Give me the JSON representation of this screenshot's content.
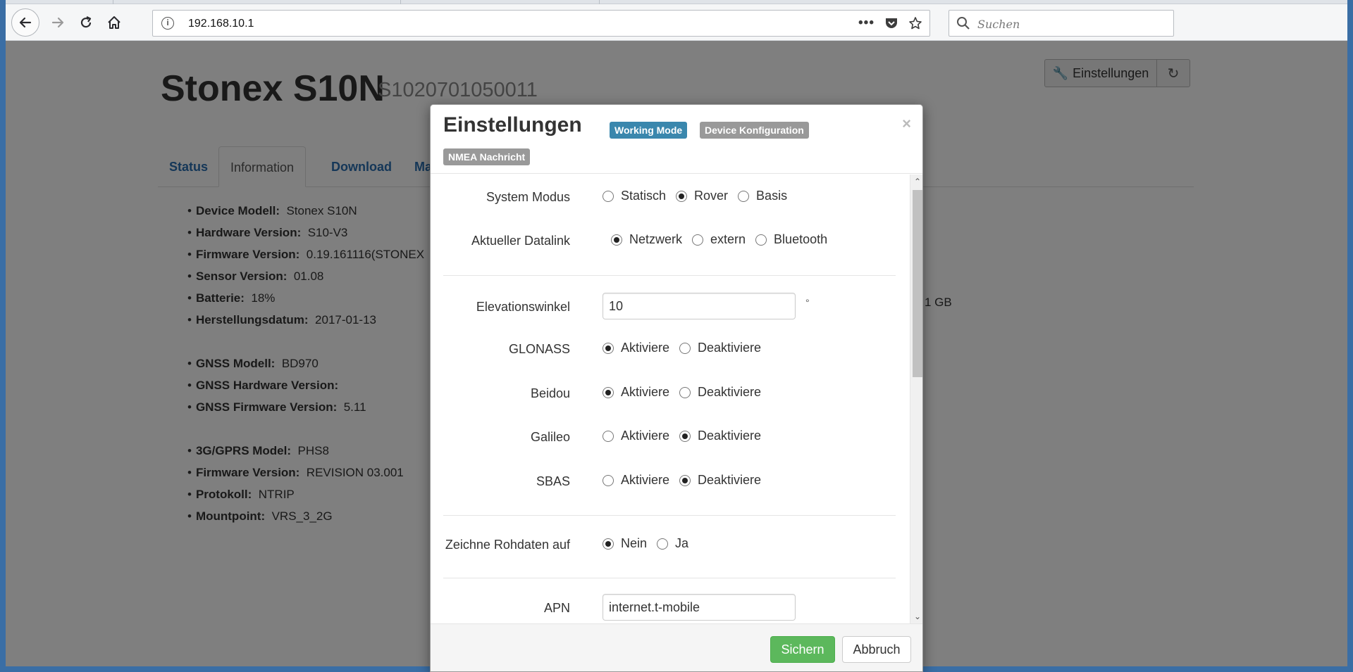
{
  "browser": {
    "url": "192.168.10.1",
    "search_placeholder": "Suchen",
    "page_actions": [
      "more-icon",
      "pocket-icon",
      "bookmark-star-icon"
    ]
  },
  "page": {
    "device_title": "Stonex S10N",
    "device_serial": "S1020701050011",
    "settings_button": "Einstellungen",
    "tabs": [
      "Status",
      "Information",
      "Download",
      "Ma"
    ],
    "active_tab": "Information",
    "info_groups": [
      [
        {
          "label": "Device Modell:",
          "value": "Stonex S10N"
        },
        {
          "label": "Hardware Version:",
          "value": "S10-V3"
        },
        {
          "label": "Firmware Version:",
          "value": "0.19.161116(STONEX"
        },
        {
          "label": "Sensor Version:",
          "value": "01.08"
        },
        {
          "label": "Batterie:",
          "value": "18%"
        },
        {
          "label": "Herstellungsdatum:",
          "value": "2017-01-13"
        }
      ],
      [
        {
          "label": "GNSS Modell:",
          "value": "BD970"
        },
        {
          "label": "GNSS Hardware Version:",
          "value": ""
        },
        {
          "label": "GNSS Firmware Version:",
          "value": "5.11"
        }
      ],
      [
        {
          "label": "3G/GPRS Model:",
          "value": "PHS8"
        },
        {
          "label": "Firmware Version:",
          "value": "REVISION 03.001"
        },
        {
          "label": "Protokoll:",
          "value": "NTRIP"
        },
        {
          "label": "Mountpoint:",
          "value": "VRS_3_2G"
        }
      ]
    ],
    "partial_right_text": "1 GB"
  },
  "modal": {
    "title": "Einstellungen",
    "badges": {
      "working_mode": "Working Mode",
      "device_config": "Device Konfiguration",
      "nmea": "NMEA Nachricht"
    },
    "close": "×",
    "system_modus": {
      "label": "System Modus",
      "options": [
        "Statisch",
        "Rover",
        "Basis"
      ],
      "selected": "Rover"
    },
    "datalink": {
      "label": "Aktueller Datalink",
      "options": [
        "Netzwerk",
        "extern",
        "Bluetooth"
      ],
      "selected": "Netzwerk"
    },
    "elevation": {
      "label": "Elevationswinkel",
      "value": "10",
      "unit": "°"
    },
    "glonass": {
      "label": "GLONASS",
      "options": [
        "Aktiviere",
        "Deaktiviere"
      ],
      "selected": "Aktiviere"
    },
    "beidou": {
      "label": "Beidou",
      "options": [
        "Aktiviere",
        "Deaktiviere"
      ],
      "selected": "Aktiviere"
    },
    "galileo": {
      "label": "Galileo",
      "options": [
        "Aktiviere",
        "Deaktiviere"
      ],
      "selected": "Deaktiviere"
    },
    "sbas": {
      "label": "SBAS",
      "options": [
        "Aktiviere",
        "Deaktiviere"
      ],
      "selected": "Deaktiviere"
    },
    "rawdata": {
      "label": "Zeichne Rohdaten auf",
      "options": [
        "Nein",
        "Ja"
      ],
      "selected": "Nein"
    },
    "apn": {
      "label": "APN",
      "value": "internet.t-mobile"
    },
    "save": "Sichern",
    "cancel": "Abbruch"
  }
}
